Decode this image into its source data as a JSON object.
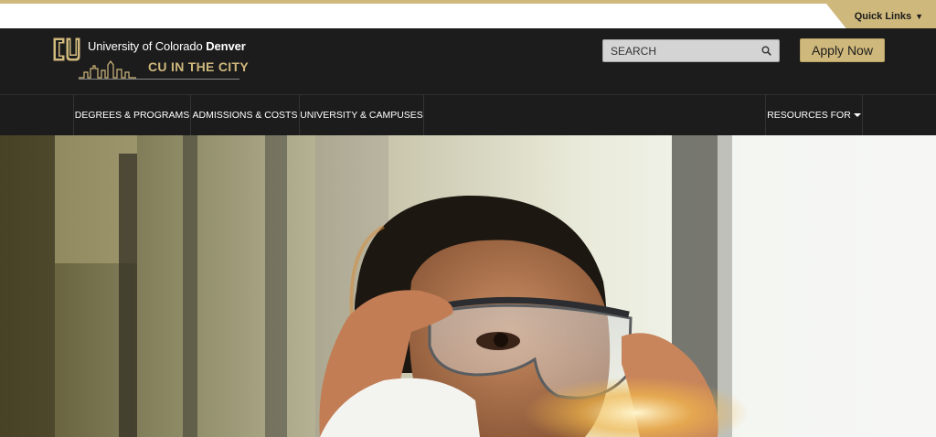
{
  "utility": {
    "quick_links_label": "Quick Links",
    "quick_links_caret": "▼"
  },
  "header": {
    "university_name_prefix": "University of Colorado ",
    "university_name_campus": "Denver",
    "tagline": "CU IN THE CITY",
    "search_placeholder": "SEARCH",
    "apply_label": "Apply Now"
  },
  "nav": {
    "items": [
      {
        "label": "DEGREES & PROGRAMS"
      },
      {
        "label": "ADMISSIONS & COSTS"
      },
      {
        "label": "UNIVERSITY & CAMPUSES"
      }
    ],
    "resources_label": "RESOURCES FOR"
  },
  "colors": {
    "gold": "#cfb87c",
    "dark": "#1c1c1c"
  },
  "hero": {
    "icon": "hero-photo-student-safety-glasses"
  }
}
